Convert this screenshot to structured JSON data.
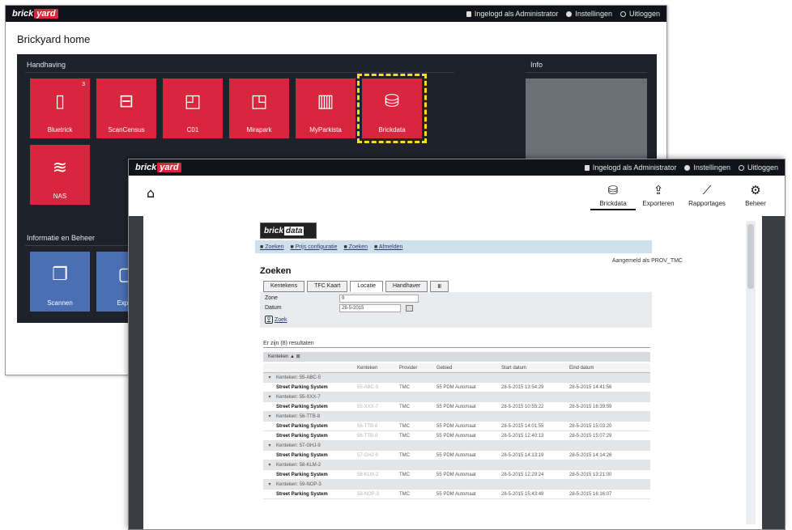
{
  "back_window": {
    "topbar": {
      "logo_part1": "brick",
      "logo_part2": "yard",
      "logged_in": "Ingelogd als Administrator",
      "settings": "Instellingen",
      "logout": "Uitloggen"
    },
    "title": "Brickyard home",
    "sections": {
      "handhaving": "Handhaving",
      "info": "Info",
      "informatie": "Informatie en Beheer"
    },
    "tiles": [
      {
        "label": "Bluetrick",
        "icon": "phone-icon",
        "badge": "3"
      },
      {
        "label": "ScanCensus",
        "icon": "scan-car-icon",
        "badge": ""
      },
      {
        "label": "C01",
        "icon": "camera-icon",
        "badge": ""
      },
      {
        "label": "Mirapark",
        "icon": "video-camera-icon",
        "badge": ""
      },
      {
        "label": "MyParkista",
        "icon": "bar-chart-icon",
        "badge": ""
      },
      {
        "label": "Brickdata",
        "icon": "database-icon",
        "badge": ""
      },
      {
        "label": "NAS",
        "icon": "wireless-icon",
        "badge": ""
      }
    ],
    "info_tiles": [
      {
        "label": "Scannen",
        "icon": "documents-icon"
      },
      {
        "label": "Export",
        "icon": "document-icon"
      }
    ]
  },
  "front_window": {
    "topbar": {
      "logo_part1": "brick",
      "logo_part2": "yard",
      "logged_in": "Ingelogd als Administrator",
      "settings": "Instellingen",
      "logout": "Uitloggen"
    },
    "toolbar": [
      {
        "label": "Brickdata",
        "icon": "database-icon",
        "active": true
      },
      {
        "label": "Exporteren",
        "icon": "export-icon",
        "active": false
      },
      {
        "label": "Rapportages",
        "icon": "chart-line-icon",
        "active": false
      },
      {
        "label": "Beheer",
        "icon": "gear-icon",
        "active": false
      }
    ],
    "brickdata": {
      "logo_part1": "brick",
      "logo_part2": "data",
      "nav": [
        "Zoeken",
        "Prijs configuratie",
        "Zoeken",
        "Afmelden"
      ],
      "logged_in_as": "Aangemeld als PROV_TMC",
      "page_title": "Zoeken",
      "tabs": [
        "Kentekens",
        "TFC Kaart",
        "Locatie",
        "Handhaver",
        "Ⅲ"
      ],
      "form": {
        "zone_label": "Zone",
        "zone_value": "9",
        "date_label": "Datum",
        "date_value": "28-5-2015",
        "search_button": "Zoek"
      },
      "results_label": "Er zijn (8) resultaten",
      "grouping_label": "Kenteken ▲ ⊠",
      "columns": [
        "",
        "",
        "Kenteken",
        "Provider",
        "Gebied",
        "Start datum",
        "Eind datum"
      ],
      "rows": [
        {
          "type": "group",
          "text": "Kenteken: 55-ABC-5"
        },
        {
          "type": "data",
          "name": "Street Parking System",
          "plate": "55-ABC-5",
          "provider": "TMC",
          "area": "55 PDM Automaat",
          "start": "28-5-2015 13:54:29",
          "end": "28-5-2015 14:41:56"
        },
        {
          "type": "group",
          "text": "Kenteken: 55-XXX-7"
        },
        {
          "type": "data",
          "name": "Street Parking System",
          "plate": "55-XXX-7",
          "provider": "TMC",
          "area": "55 PDM Automaat",
          "start": "28-5-2015 10:55:22",
          "end": "28-5-2015 16:39:59"
        },
        {
          "type": "group",
          "text": "Kenteken: 56-TTB-8"
        },
        {
          "type": "data",
          "name": "Street Parking System",
          "plate": "56-TTB-8",
          "provider": "TMC",
          "area": "55 PDM Automaat",
          "start": "28-5-2015 14:01:55",
          "end": "28-5-2015 15:03:20"
        },
        {
          "type": "data",
          "name": "Street Parking System",
          "plate": "56-TTB-8",
          "provider": "TMC",
          "area": "55 PDM Automaat",
          "start": "28-5-2015 12:40:13",
          "end": "28-5-2015 15:07:29"
        },
        {
          "type": "group",
          "text": "Kenteken: 57-GHJ-9"
        },
        {
          "type": "data",
          "name": "Street Parking System",
          "plate": "57-GHJ-9",
          "provider": "TMC",
          "area": "55 PDM Automaat",
          "start": "28-5-2015 14:13:19",
          "end": "28-5-2015 14:14:26"
        },
        {
          "type": "group",
          "text": "Kenteken: 58-KLM-2"
        },
        {
          "type": "data",
          "name": "Street Parking System",
          "plate": "58-KLM-2",
          "provider": "TMC",
          "area": "55 PDM Automaat",
          "start": "28-5-2015 12:29:24",
          "end": "28-5-2015 13:21:00"
        },
        {
          "type": "group",
          "text": "Kenteken: 59-NOP-3"
        },
        {
          "type": "data",
          "name": "Street Parking System",
          "plate": "59-NOP-3",
          "provider": "TMC",
          "area": "55 PDM Automaat",
          "start": "28-5-2015 15:43:49",
          "end": "28-5-2015 16:16:07"
        }
      ]
    }
  }
}
